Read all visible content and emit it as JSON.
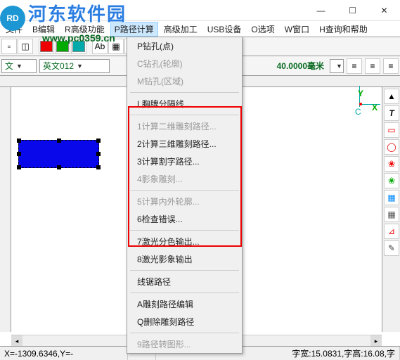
{
  "watermark": {
    "title": "河东软件园",
    "url": "www.pc0359.cn"
  },
  "window_controls": {
    "min": "—",
    "max": "☐",
    "close": "✕"
  },
  "menubar": {
    "items": [
      {
        "label": "文件"
      },
      {
        "label": "B编辑"
      },
      {
        "label": "R高级功能"
      },
      {
        "label": "P路径计算"
      },
      {
        "label": "高级加工"
      },
      {
        "label": "USB设备"
      },
      {
        "label": "O选项"
      },
      {
        "label": "W窗口"
      },
      {
        "label": "H查询和帮助"
      }
    ],
    "active_index": 3
  },
  "dropdown": {
    "items": [
      {
        "label": "P钻孔(点)",
        "disabled": false
      },
      {
        "label": "C钻孔(轮廓)",
        "disabled": true
      },
      {
        "label": "M钻孔(区域)",
        "disabled": true
      },
      {
        "sep": true
      },
      {
        "label": "L胸牌分隔线...",
        "disabled": false
      },
      {
        "sep": true
      },
      {
        "label": "1计算二维雕刻路径...",
        "disabled": true
      },
      {
        "label": "2计算三维雕刻路径...",
        "disabled": false
      },
      {
        "label": "3计算割字路径...",
        "disabled": false
      },
      {
        "label": "4影象雕刻...",
        "disabled": true
      },
      {
        "sep": true
      },
      {
        "label": "5计算内外轮廓...",
        "disabled": true
      },
      {
        "label": "6检查错误...",
        "disabled": false
      },
      {
        "sep": true
      },
      {
        "label": "7激光分色输出...",
        "disabled": false
      },
      {
        "label": "8激光影象输出",
        "disabled": false
      },
      {
        "sep": true
      },
      {
        "label": "线锯路径",
        "disabled": false
      },
      {
        "sep": true
      },
      {
        "label": "A雕刻路径编辑",
        "disabled": false
      },
      {
        "label": "Q删除雕刻路径",
        "disabled": false
      },
      {
        "sep": true
      },
      {
        "label": "9路径转图形...",
        "disabled": true
      }
    ]
  },
  "toolbar2": {
    "lang1": "文",
    "font": "英文012",
    "size": "40.0000毫米"
  },
  "colors": {
    "c1": "#e00000",
    "c2": "#00a000",
    "c3": "#00a0a0"
  },
  "right_tools": [
    "▲",
    "T",
    "▭",
    "◯",
    "❀",
    "❀",
    "▦",
    "▦",
    "⊿",
    "✎"
  ],
  "right_tool_colors": [
    "#000",
    "#000",
    "#e00",
    "#e00",
    "#e00",
    "#0a0",
    "#08f",
    "#555",
    "#e00",
    "#444"
  ],
  "canvas_coords": {
    "x": "X",
    "y": "Y",
    "cx": "C",
    "cy": "C"
  },
  "status": {
    "xy": "X=-1309.6346,Y=-",
    "font": "字宽:15.0831,字高:16.08,字"
  },
  "icons": {
    "sq": "■",
    "color_r": "■",
    "color_g": "■",
    "color_c": "■",
    "ab": "Ab",
    "align": "≡",
    "box": "▭"
  }
}
